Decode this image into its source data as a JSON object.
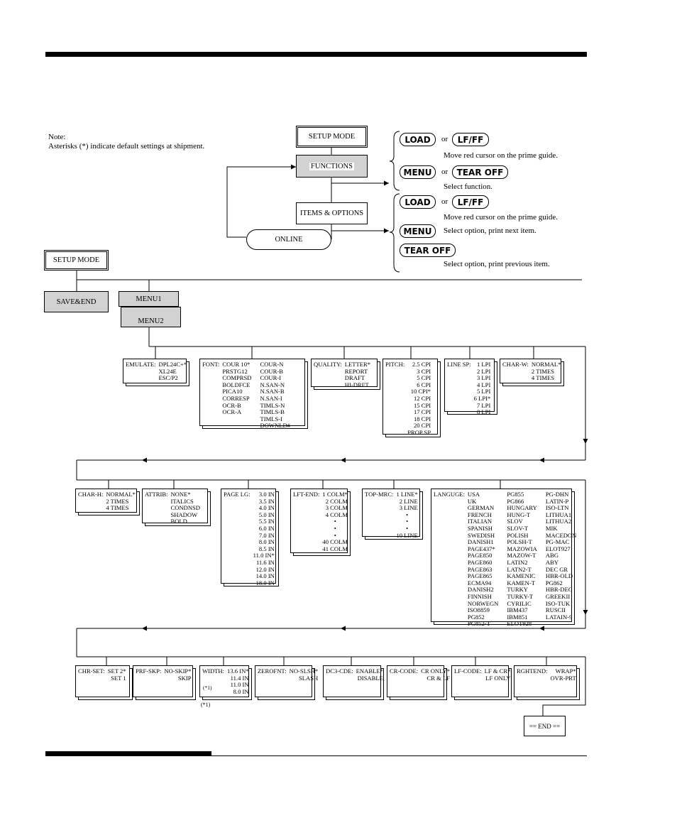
{
  "note": {
    "title": "Note:",
    "text": "Asterisks (*) indicate default settings at shipment."
  },
  "flow": {
    "setup_mode": "SETUP MODE",
    "functions": "FUNCTIONS",
    "items_options": "ITEMS & OPTIONS",
    "online": "ONLINE"
  },
  "keys": {
    "group1": {
      "load": "LOAD",
      "or1": "or",
      "lfff": "LF/FF",
      "move_desc": "Move red cursor on the prime guide.",
      "menu": "MENU",
      "or2": "or",
      "tearoff": "TEAR OFF",
      "select_desc": "Select function."
    },
    "group2": {
      "load": "LOAD",
      "or1": "or",
      "lfff": "LF/FF",
      "move_desc": "Move red cursor on the prime guide.",
      "menu": "MENU",
      "menu_desc": "Select option, print next item.",
      "tearoff": "TEAR OFF",
      "tearoff_desc": "Select option, print previous item."
    }
  },
  "tree": {
    "setup_mode": "SETUP MODE",
    "save_end": "SAVE&END",
    "menu1": "MENU1",
    "menu2": "MENU2",
    "end": "== END ==",
    "footnote": "(*1)"
  },
  "menu_boxes": [
    {
      "label": "EMULATE:",
      "columns": [
        [
          "DPL24C+*",
          "XL24E",
          "ESC/P2"
        ]
      ]
    },
    {
      "label": "FONT:",
      "columns": [
        [
          "COUR 10*",
          "PRSTG12",
          "COMPRSD",
          "BOLDFCE",
          "PICA10",
          "CORRESP",
          "OCR-B",
          "OCR-A"
        ],
        [
          "COUR-N",
          "COUR-B",
          "COUR-I",
          "N.SAN-N",
          "N.SAN-B",
          "N.SAN-I",
          "TIMLS-N",
          "TIMLS-B",
          "TIMLS-I",
          "DOWNLD#"
        ]
      ]
    },
    {
      "label": "QUALITY:",
      "columns": [
        [
          "LETTER*",
          "REPORT",
          "DRAFT",
          "HI-DRFT"
        ]
      ]
    },
    {
      "label": "PITCH:",
      "columns": [
        [
          "2.5 CPI",
          "3 CPI",
          "5 CPI",
          "6 CPI",
          "10 CPI*",
          "12 CPI",
          "15 CPI",
          "17 CPI",
          "18 CPI",
          "20 CPI",
          "PROP SP"
        ]
      ]
    },
    {
      "label": "LINE SP:",
      "columns": [
        [
          "1 LPI",
          "2 LPI",
          "3 LPI",
          "4 LPI",
          "5 LPI",
          "6 LPI*",
          "7 LPI",
          "8 LPI"
        ]
      ]
    },
    {
      "label": "CHAR-W:",
      "columns": [
        [
          "NORMAL*",
          "2 TIMES",
          "4 TIMES"
        ]
      ]
    },
    {
      "label": "CHAR-H:",
      "columns": [
        [
          "NORMAL*",
          "2 TIMES",
          "4 TIMES"
        ]
      ]
    },
    {
      "label": "ATTRIB:",
      "columns": [
        [
          "NONE*",
          "ITALICS",
          "CONDNSD",
          "SHADOW",
          "BOLD"
        ]
      ]
    },
    {
      "label": "PAGE LG:",
      "columns": [
        [
          "3.0 IN",
          "3.5 IN",
          "4.0 IN",
          "5.0 IN",
          "5.5 IN",
          "6.0 IN",
          "7.0 IN",
          "8.0 IN",
          "8.5 IN",
          "11.0 IN*",
          "11.6 IN",
          "12.0 IN",
          "14.0 IN",
          "18.0 IN"
        ]
      ]
    },
    {
      "label": "LFT-END:",
      "columns": [
        [
          "1 COLM*",
          "2 COLM",
          "3 COLM",
          "4 COLM",
          "•",
          "•",
          "•",
          "40 COLM",
          "41 COLM"
        ]
      ]
    },
    {
      "label": "TOP-MRC:",
      "columns": [
        [
          "1 LINE*",
          "2 LINE",
          "3 LINE",
          "•",
          "•",
          "•",
          "10 LINE"
        ]
      ]
    },
    {
      "label": "LANGUGE:",
      "columns": [
        [
          "USA",
          "UK",
          "GERMAN",
          "FRENCH",
          "ITALIAN",
          "SPANISH",
          "SWEDISH",
          "DANISH1",
          "PAGE437*",
          "PAGE850",
          "PAGE860",
          "PAGE863",
          "PAGE865",
          "ECMA94",
          "DANISH2",
          "FINNISH",
          "NORWEGN",
          "ISO8859",
          "PG852",
          "PG852-T"
        ],
        [
          "PG855",
          "PG866",
          "HUNGARY",
          "HUNG-T",
          "SLOV",
          "SLOV-T",
          "POLISH",
          "POLSH-T",
          "MAZOWIA",
          "MAZOW-T",
          "LATIN2",
          "LATN2-T",
          "KAMENIC",
          "KAMEN-T",
          "TURKY",
          "TURKY-T",
          "CYRILIC",
          "IBM437",
          "IBM851",
          "ELOT928"
        ],
        [
          "PG-DHN",
          "LATIN-P",
          "ISO-LTN",
          "LITHUA1",
          "LITHUA2",
          "MIK",
          "MACEDON",
          "PG-MAC",
          "ELOT927",
          "ABG",
          "ABY",
          "DEC GR",
          "HBR-OLD",
          "PG862",
          "HBR-DEC",
          "GREEKII",
          "ISO-TUK",
          "RUSCII",
          "LATAIN-9"
        ]
      ]
    },
    {
      "label": "CHR-SET:",
      "columns": [
        [
          "SET 2*",
          "SET 1"
        ]
      ]
    },
    {
      "label": "PRF-SKP:",
      "columns": [
        [
          "NO-SKIP*",
          "SKIP"
        ]
      ]
    },
    {
      "label": "WIDTH:",
      "columns": [
        [
          "13.6 IN*",
          "11.4 IN",
          "11.0 IN",
          "8.0 IN"
        ]
      ],
      "note": "(*1)"
    },
    {
      "label": "ZEROFNT:",
      "columns": [
        [
          "NO-SLSH*",
          "SLASH"
        ]
      ]
    },
    {
      "label": "DC3-CDE:",
      "columns": [
        [
          "ENABLE*",
          "DISABLE"
        ]
      ]
    },
    {
      "label": "CR-CODE:",
      "columns": [
        [
          "CR ONLY*",
          "CR & LF"
        ]
      ]
    },
    {
      "label": "LF-CODE:",
      "columns": [
        [
          "LF & CR*",
          "LF ONLY"
        ]
      ]
    },
    {
      "label": "RGHTEND:",
      "columns": [
        [
          "WRAP*",
          "OVR-PRT"
        ]
      ]
    }
  ],
  "colors": {
    "box_fill_gray": "#d2d2d2",
    "line": "#000000"
  }
}
